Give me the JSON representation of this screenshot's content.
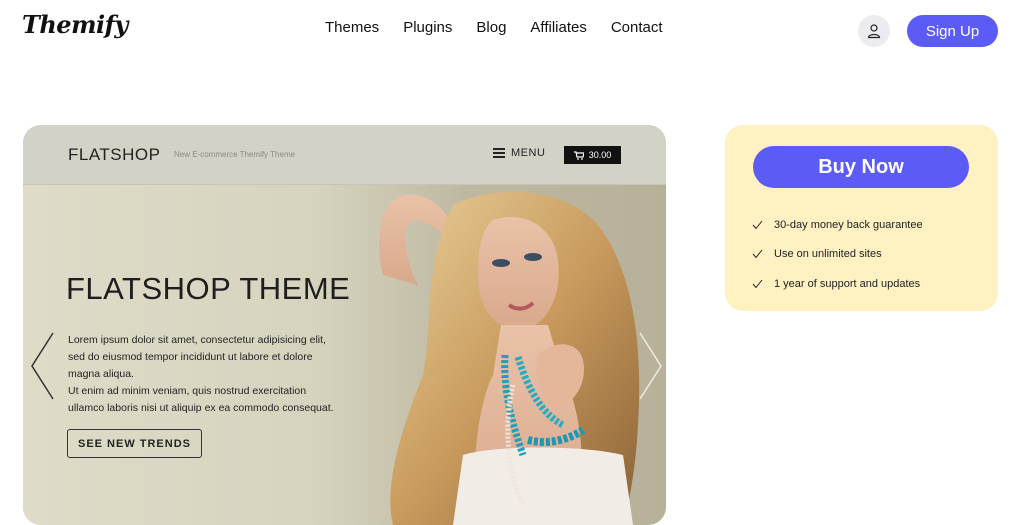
{
  "header": {
    "logo": "Themify",
    "nav": [
      "Themes",
      "Plugins",
      "Blog",
      "Affiliates",
      "Contact"
    ],
    "signup_label": "Sign Up",
    "user_icon": "user-icon"
  },
  "preview": {
    "brand": "FLATSHOP",
    "tagline": "New E-commerce Themify Theme",
    "menu_label": "MENU",
    "cart_amount": "30.00",
    "title": "FLATSHOP THEME",
    "text_lines": [
      "Lorem ipsum dolor sit amet, consectetur adipisicing elit,",
      "sed do eiusmod tempor incididunt ut labore et dolore",
      "magna aliqua.",
      "Ut enim ad minim veniam, quis nostrud exercitation",
      "ullamco laboris nisi ut aliquip ex ea commodo consequat."
    ],
    "cta": "SEE NEW TRENDS"
  },
  "buy": {
    "button_label": "Buy Now",
    "features": [
      "30-day money back guarantee",
      "Use on unlimited sites",
      "1 year of support and updates"
    ]
  },
  "colors": {
    "accent": "#5b5cf6",
    "buy_box_bg": "#fff1c2"
  }
}
